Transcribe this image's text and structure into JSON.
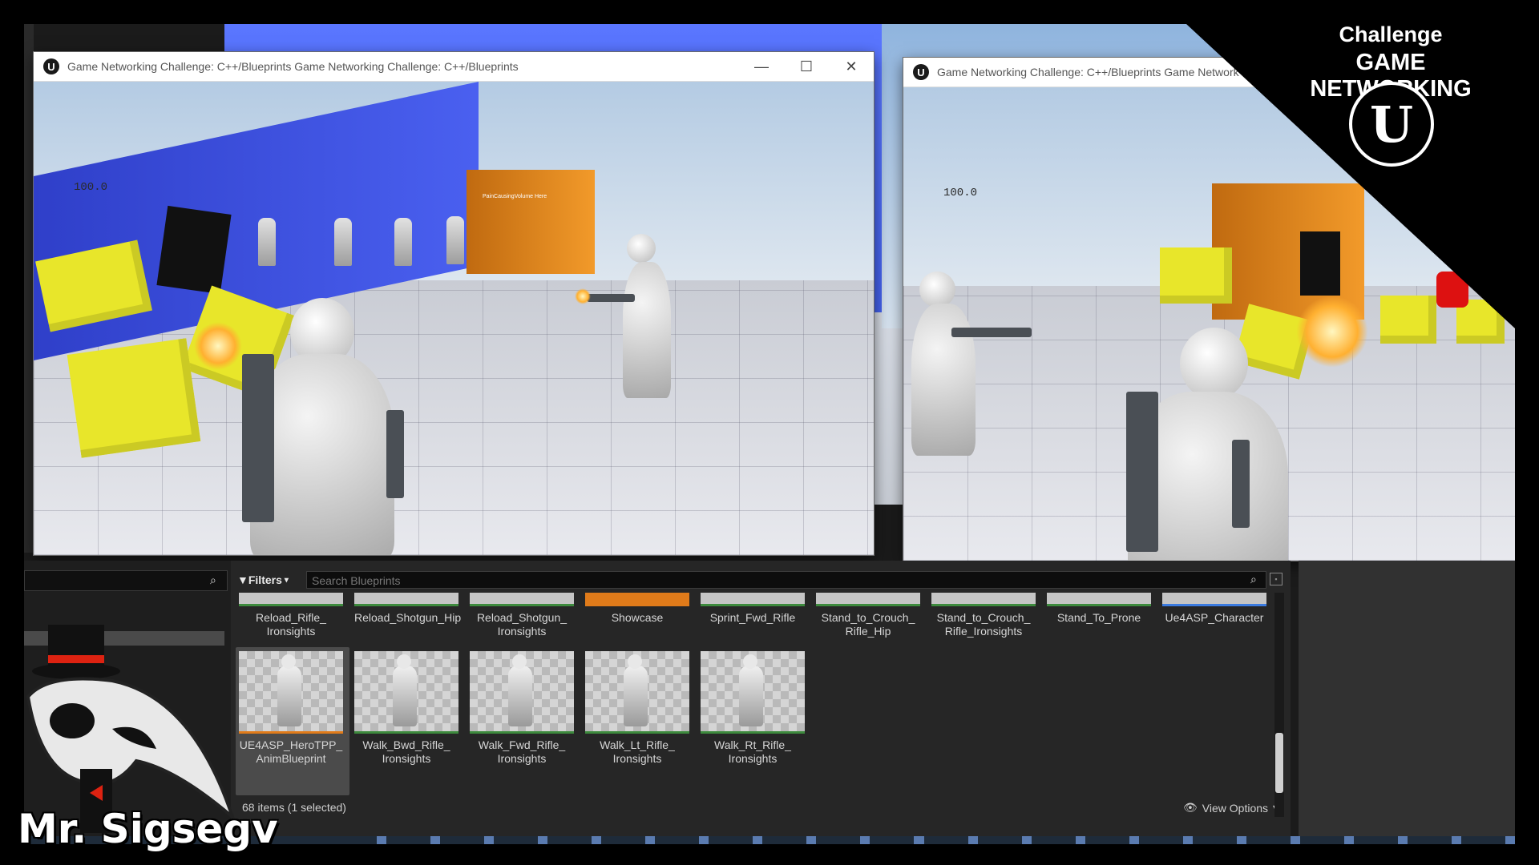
{
  "window1": {
    "title": "Game Networking Challenge: C++/Blueprints Game Networking Challenge: C++/Blueprints",
    "health": "100.0",
    "volume_text": "PainCausingVolume Here"
  },
  "window2": {
    "title": "Game Networking Challenge: C++/Blueprints Game Network",
    "health": "100.0"
  },
  "branding": {
    "line1": "Challenge",
    "line2": "GAME NETWORKING",
    "logo_glyph": "U",
    "author": "Mr. Sigsegv"
  },
  "content_browser": {
    "filters_label": "Filters",
    "search_placeholder": "Search Blueprints",
    "top_row": [
      {
        "l1": "Reload_Rifle_",
        "l2": "Ironsights"
      },
      {
        "l1": "Reload_Shotgun_Hip",
        "l2": ""
      },
      {
        "l1": "Reload_Shotgun_",
        "l2": "Ironsights"
      },
      {
        "l1": "Showcase",
        "l2": ""
      },
      {
        "l1": "Sprint_Fwd_Rifle",
        "l2": ""
      },
      {
        "l1": "Stand_to_Crouch_",
        "l2": "Rifle_Hip"
      },
      {
        "l1": "Stand_to_Crouch_",
        "l2": "Rifle_Ironsights"
      },
      {
        "l1": "Stand_To_Prone",
        "l2": ""
      },
      {
        "l1": "Ue4ASP_Character",
        "l2": ""
      }
    ],
    "bottom_row": [
      {
        "l1": "UE4ASP_HeroTPP_",
        "l2": "AnimBlueprint"
      },
      {
        "l1": "Walk_Bwd_Rifle_",
        "l2": "Ironsights"
      },
      {
        "l1": "Walk_Fwd_Rifle_",
        "l2": "Ironsights"
      },
      {
        "l1": "Walk_Lt_Rifle_",
        "l2": "Ironsights"
      },
      {
        "l1": "Walk_Rt_Rifle_",
        "l2": "Ironsights"
      }
    ],
    "status": "68 items (1 selected)",
    "view_options": "View Options"
  },
  "window_buttons": {
    "minimize": "—",
    "maximize": "☐",
    "close": "✕"
  },
  "colors": {
    "accent_selected": "#e07b1a",
    "animbp_border": "#3d8a3d"
  }
}
